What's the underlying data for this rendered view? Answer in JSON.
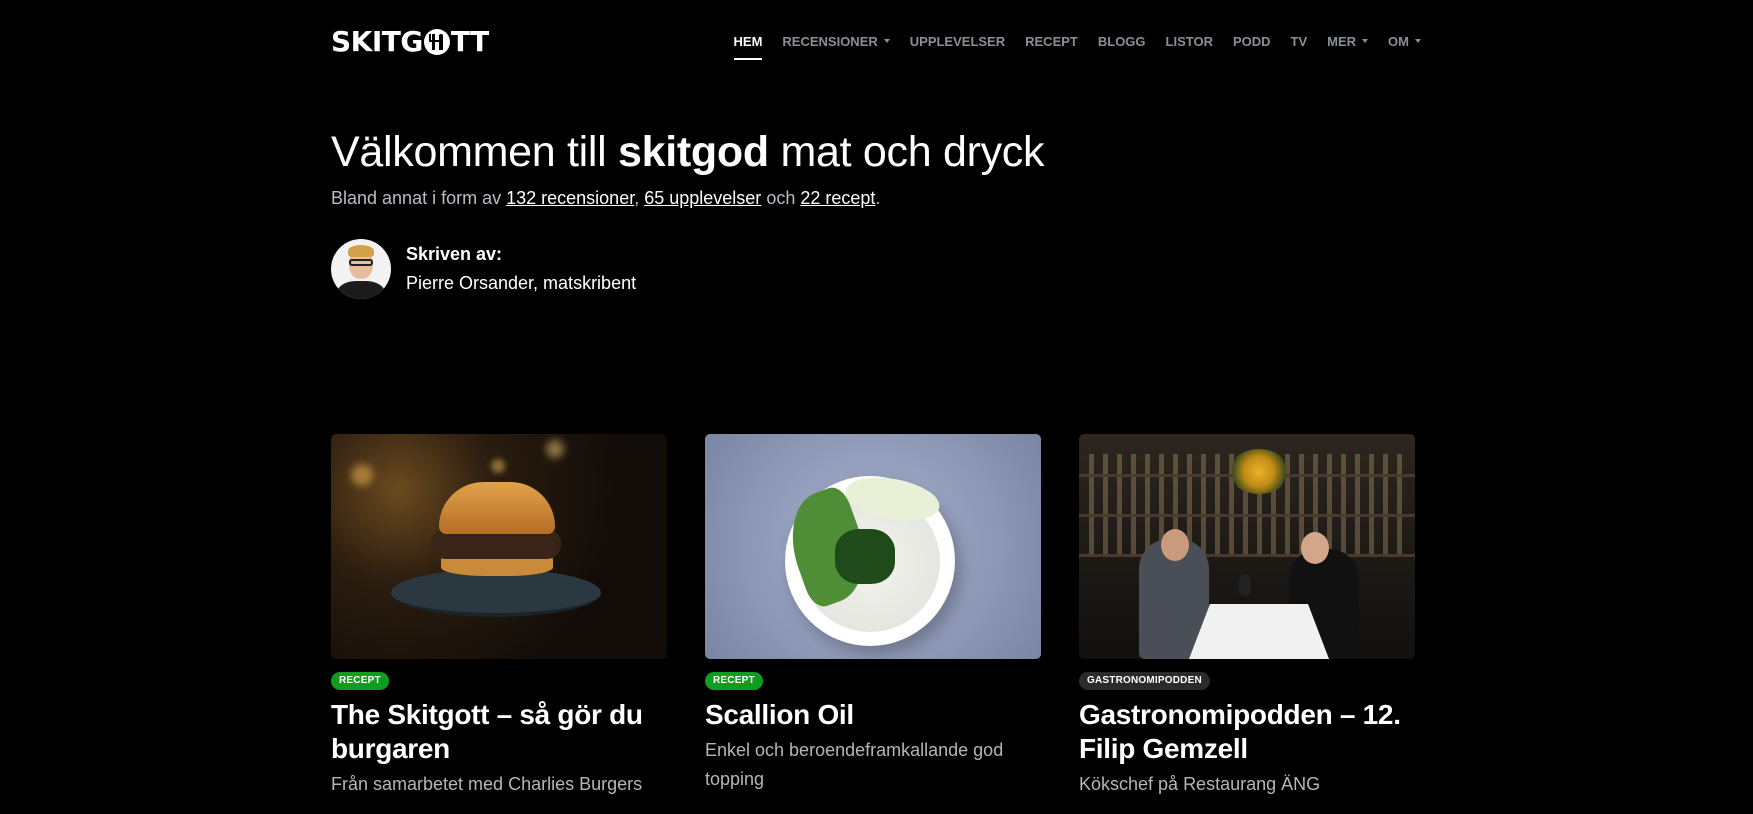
{
  "brand": {
    "logo_text_a": "SKITG",
    "logo_text_b": "TT"
  },
  "nav": {
    "items": [
      {
        "label": "HEM",
        "active": true,
        "dropdown": false
      },
      {
        "label": "RECENSIONER",
        "active": false,
        "dropdown": true
      },
      {
        "label": "UPPLEVELSER",
        "active": false,
        "dropdown": false
      },
      {
        "label": "RECEPT",
        "active": false,
        "dropdown": false
      },
      {
        "label": "BLOGG",
        "active": false,
        "dropdown": false
      },
      {
        "label": "LISTOR",
        "active": false,
        "dropdown": false
      },
      {
        "label": "PODD",
        "active": false,
        "dropdown": false
      },
      {
        "label": "TV",
        "active": false,
        "dropdown": false
      },
      {
        "label": "MER",
        "active": false,
        "dropdown": true
      },
      {
        "label": "OM",
        "active": false,
        "dropdown": true
      }
    ]
  },
  "hero": {
    "title_pre": "Välkommen till ",
    "title_bold": "skitgod",
    "title_post": " mat och dryck",
    "sub_pre": "Bland annat i form av ",
    "link_reviews": "132 recensioner",
    "sep": ", ",
    "link_experiences": "65 upplevelser",
    "and": " och ",
    "link_recipes": "22 recept",
    "end": "."
  },
  "author": {
    "label": "Skriven av:",
    "name": "Pierre Orsander, matskribent"
  },
  "cards": [
    {
      "badge": "RECEPT",
      "badge_color": "#0f9d1f",
      "title": "The Skitgott – så gör du burgaren",
      "desc": "Från samarbetet med Charlies Burgers"
    },
    {
      "badge": "RECEPT",
      "badge_color": "#0f9d1f",
      "title": "Scallion Oil",
      "desc": "Enkel och beroendeframkallande god topping"
    },
    {
      "badge": "GASTRONOMIPODDEN",
      "badge_color": "#2b2b2b",
      "title": "Gastronomipodden – 12. Filip Gemzell",
      "desc": "Kökschef på Restaurang ÄNG"
    }
  ]
}
